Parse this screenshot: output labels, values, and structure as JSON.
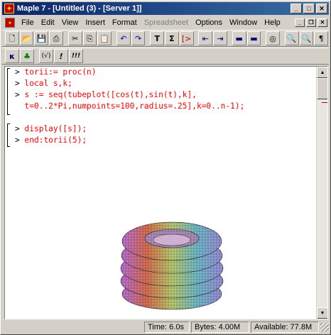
{
  "window": {
    "title": "Maple 7 - [Untitled (3) - [Server 1]]"
  },
  "menubar": {
    "items": [
      {
        "label": "File",
        "disabled": false
      },
      {
        "label": "Edit",
        "disabled": false
      },
      {
        "label": "View",
        "disabled": false
      },
      {
        "label": "Insert",
        "disabled": false
      },
      {
        "label": "Format",
        "disabled": false
      },
      {
        "label": "Spreadsheet",
        "disabled": true
      },
      {
        "label": "Options",
        "disabled": false
      },
      {
        "label": "Window",
        "disabled": false
      },
      {
        "label": "Help",
        "disabled": false
      }
    ]
  },
  "toolbar": {
    "buttons": [
      "new-icon",
      "open-icon",
      "save-icon",
      "print-icon",
      "cut-icon",
      "copy-icon",
      "paste-icon",
      "undo-icon",
      "redo-icon",
      "text-icon",
      "math-icon",
      "execution-group-icon",
      "outdent-icon",
      "indent-icon",
      "restart-icon",
      "stop-icon",
      "zoom-in-icon",
      "zoom-out-icon",
      "zoom-fit-icon",
      "paragraph-marks-icon"
    ]
  },
  "context_toolbar": {
    "buttons": [
      {
        "icon": "text-mode-icon",
        "glyph": "κ"
      },
      {
        "icon": "math-mode-icon",
        "glyph": "♣"
      },
      {
        "icon": "inert-text-icon",
        "glyph": "(√)"
      },
      {
        "icon": "execute-icon",
        "glyph": "!"
      },
      {
        "icon": "execute-all-icon",
        "glyph": "!!!"
      }
    ]
  },
  "worksheet": {
    "prompt": ">",
    "lines": [
      "torii:= proc(n)",
      "local s,k;",
      "s := seq(tubeplot([cos(t),sin(t),k],",
      "t=0..2*Pi,numpoints=100,radius=.25],k=0..n-1);",
      "display([s]);",
      "end:torii(5);"
    ]
  },
  "status": {
    "time": "Time: 6.0s",
    "bytes": "Bytes: 4.00M",
    "available": "Available: 77.8M"
  }
}
